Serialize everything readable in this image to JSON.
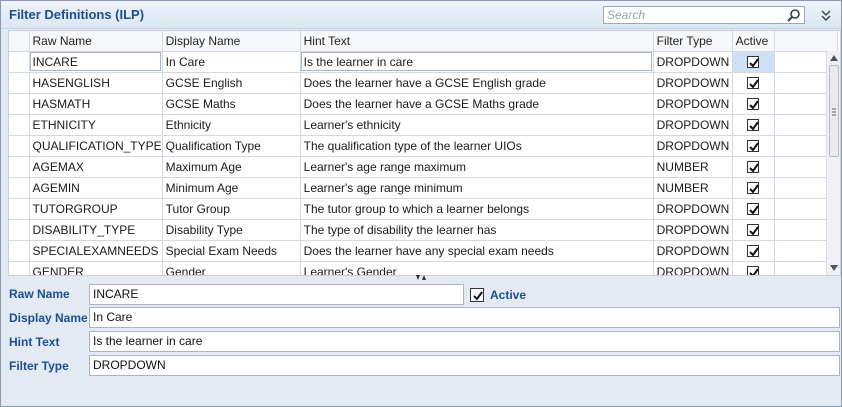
{
  "window": {
    "title": "Filter Definitions (ILP)",
    "search_placeholder": "Search"
  },
  "grid": {
    "columns": [
      "Raw Name",
      "Display Name",
      "Hint Text",
      "Filter Type",
      "Active"
    ],
    "rows": [
      {
        "raw": "INCARE",
        "display": "In Care",
        "hint": "Is the learner in care",
        "type": "DROPDOWN",
        "active": true
      },
      {
        "raw": "HASENGLISH",
        "display": "GCSE English",
        "hint": "Does the learner have a GCSE English grade",
        "type": "DROPDOWN",
        "active": true
      },
      {
        "raw": "HASMATH",
        "display": "GCSE Maths",
        "hint": "Does the learner have a GCSE Maths grade",
        "type": "DROPDOWN",
        "active": true
      },
      {
        "raw": "ETHNICITY",
        "display": "Ethnicity",
        "hint": "Learner's ethnicity",
        "type": "DROPDOWN",
        "active": true
      },
      {
        "raw": "QUALIFICATION_TYPE",
        "display": "Qualification Type",
        "hint": "The qualification type of the learner UIOs",
        "type": "DROPDOWN",
        "active": true
      },
      {
        "raw": "AGEMAX",
        "display": "Maximum Age",
        "hint": "Learner's age range maximum",
        "type": "NUMBER",
        "active": true
      },
      {
        "raw": "AGEMIN",
        "display": "Minimum Age",
        "hint": "Learner's age range minimum",
        "type": "NUMBER",
        "active": true
      },
      {
        "raw": "TUTORGROUP",
        "display": "Tutor Group",
        "hint": "The tutor group to which a learner belongs",
        "type": "DROPDOWN",
        "active": true
      },
      {
        "raw": "DISABILITY_TYPE",
        "display": "Disability Type",
        "hint": "The type of disability the learner has",
        "type": "DROPDOWN",
        "active": true
      },
      {
        "raw": "SPECIALEXAMNEEDS",
        "display": "Special Exam Needs",
        "hint": "Does the learner have any special exam needs",
        "type": "DROPDOWN",
        "active": true
      },
      {
        "raw": "GENDER",
        "display": "Gender",
        "hint": "Learner's Gender",
        "type": "DROPDOWN",
        "active": true
      }
    ]
  },
  "form": {
    "raw_name_label": "Raw Name",
    "raw_name_value": "INCARE",
    "active_label": "Active",
    "active_checked": true,
    "display_name_label": "Display Name",
    "display_name_value": "In Care",
    "hint_text_label": "Hint Text",
    "hint_text_value": "Is the learner in care",
    "filter_type_label": "Filter Type",
    "filter_type_value": "DROPDOWN"
  },
  "colors": {
    "accent": "#1b4f91",
    "panel_background": "#e4eaf3"
  },
  "icons": [
    "search-icon",
    "collapse-chevrons-icon",
    "checkbox-checked-icon",
    "splitter-grip-icon",
    "scroll-up-icon",
    "scroll-down-icon"
  ]
}
